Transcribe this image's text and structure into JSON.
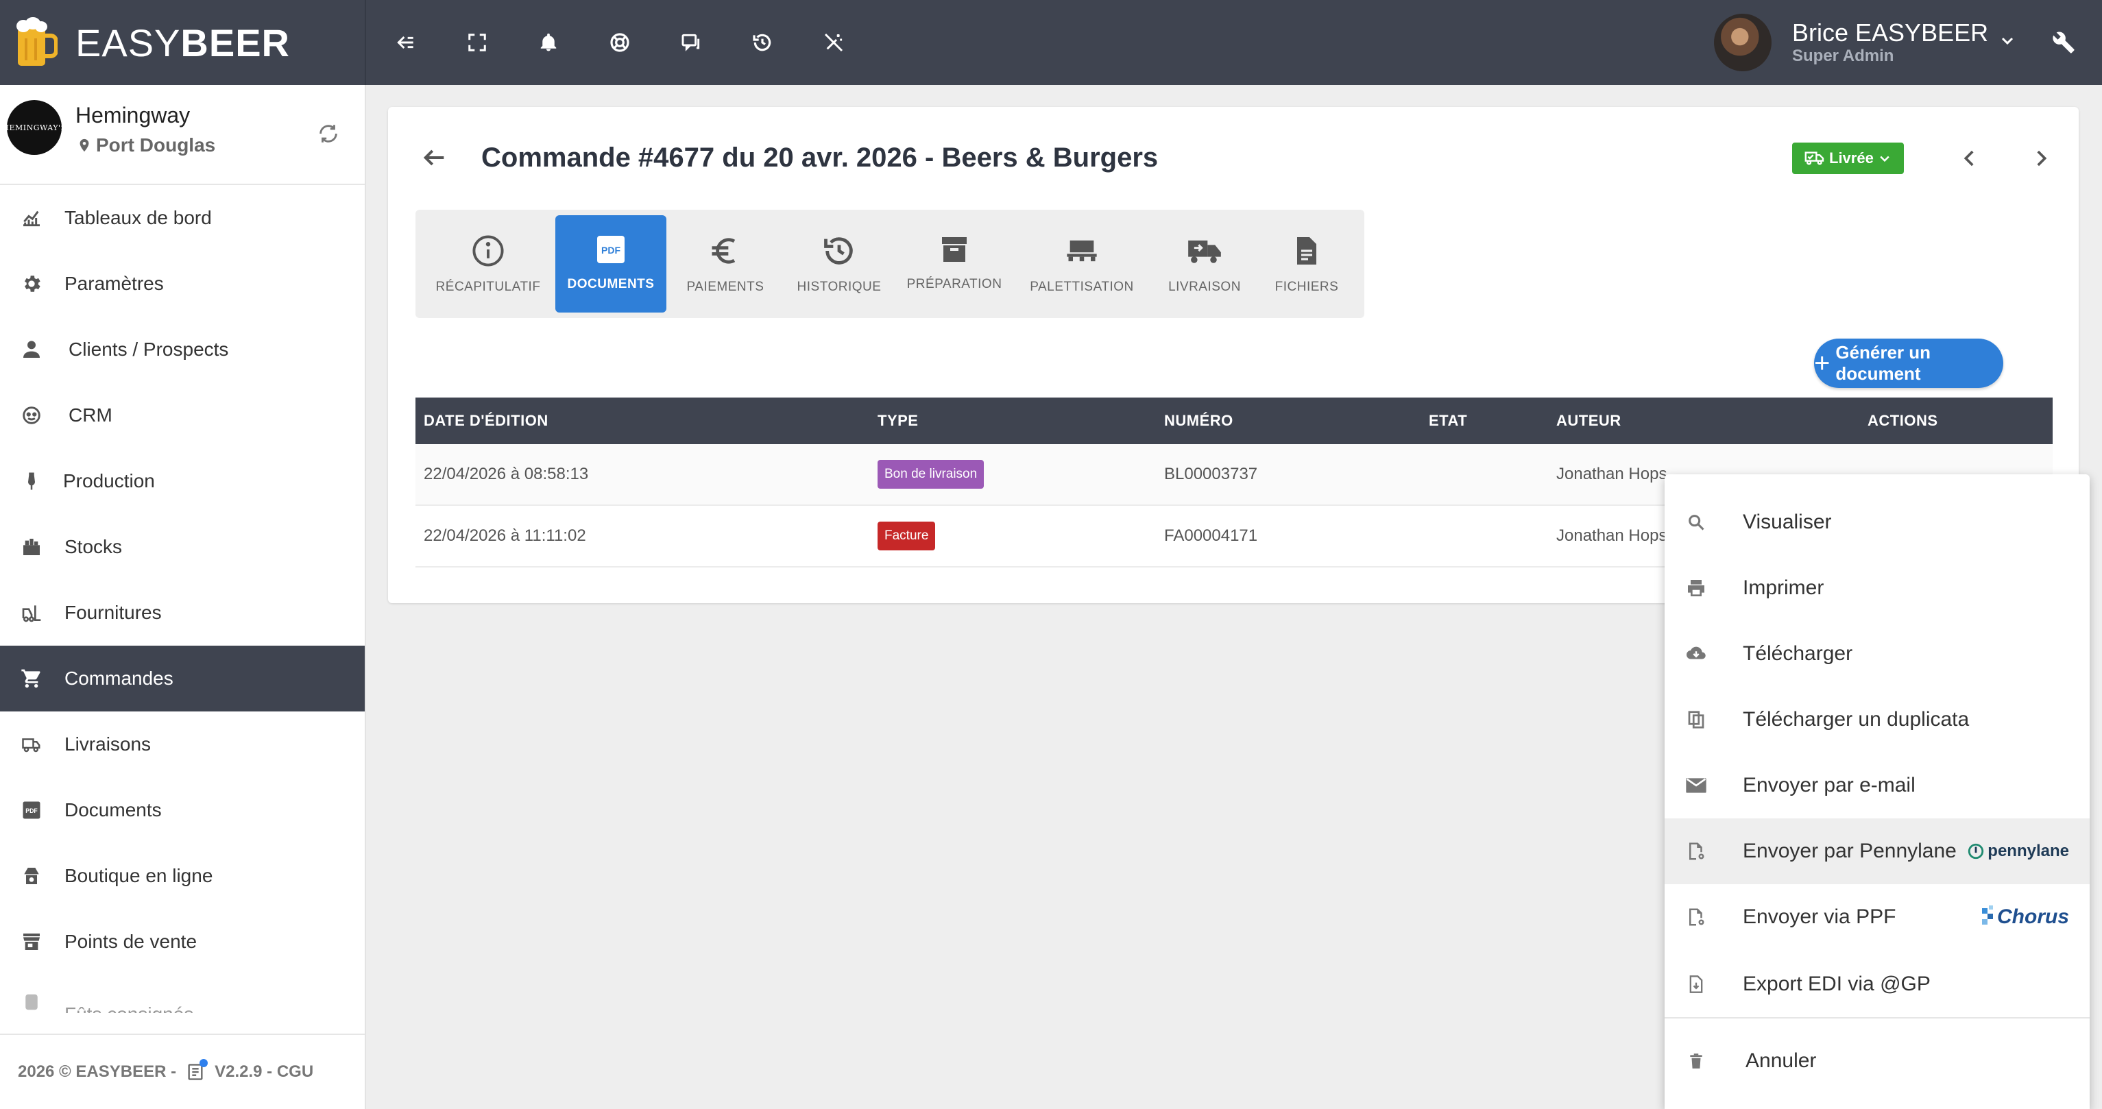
{
  "app": {
    "brand_light": "EASY",
    "brand_bold": "BEER",
    "user_name": "Brice EASYBEER",
    "user_role": "Super Admin"
  },
  "colors": {
    "topbar": "#3f4450",
    "accent": "#2f7fd8",
    "status_green": "#3aa935",
    "badge_bl": "#9b59b6",
    "badge_fa": "#c62828"
  },
  "toolbar_icons": [
    "collapse-menu-icon",
    "fullscreen-icon",
    "bell-icon",
    "support-icon",
    "messages-icon",
    "history-icon",
    "no-magic-icon"
  ],
  "brewery": {
    "logo_text": "HEMINGWAY'S",
    "name": "Hemingway",
    "city": "Port Douglas"
  },
  "sidebar": {
    "items": [
      {
        "label": "Tableaux de bord",
        "icon": "dashboard-icon"
      },
      {
        "label": "Paramètres",
        "icon": "gear-icon"
      },
      {
        "label": "Clients / Prospects",
        "icon": "person-icon"
      },
      {
        "label": "CRM",
        "icon": "crm-icon"
      },
      {
        "label": "Production",
        "icon": "beer-tap-icon"
      },
      {
        "label": "Stocks",
        "icon": "stocks-icon"
      },
      {
        "label": "Fournitures",
        "icon": "forklift-icon"
      },
      {
        "label": "Commandes",
        "icon": "cart-icon"
      },
      {
        "label": "Livraisons",
        "icon": "truck-icon"
      },
      {
        "label": "Documents",
        "icon": "pdf-icon"
      },
      {
        "label": "Boutique en ligne",
        "icon": "shop-icon"
      },
      {
        "label": "Points de vente",
        "icon": "store-icon"
      },
      {
        "label": "Fûts consignés",
        "icon": "keg-icon"
      }
    ],
    "footer_copyright": "2026 © EASYBEER -",
    "footer_version": "V2.2.9 - CGU"
  },
  "order": {
    "title": "Commande #4677 du 20 avr. 2026 - Beers & Burgers",
    "status": "Livrée"
  },
  "tabs": [
    {
      "label": "RÉCAPITULATIF",
      "icon": "info-icon"
    },
    {
      "label": "DOCUMENTS",
      "icon": "pdf-icon"
    },
    {
      "label": "PAIEMENTS",
      "icon": "euro-icon"
    },
    {
      "label": "HISTORIQUE",
      "icon": "history-icon"
    },
    {
      "label": "PRÉPARATION",
      "icon": "archive-icon"
    },
    {
      "label": "PALETTISATION",
      "icon": "pallet-icon"
    },
    {
      "label": "LIVRAISON",
      "icon": "delivery-truck-icon"
    },
    {
      "label": "FICHIERS",
      "icon": "file-icon"
    }
  ],
  "generate_button": "Générer un document",
  "table": {
    "headers": [
      "DATE D'ÉDITION",
      "TYPE",
      "NUMÉRO",
      "ETAT",
      "AUTEUR",
      "ACTIONS"
    ],
    "rows": [
      {
        "date": "22/04/2026 à 08:58:13",
        "type": "Bon de livraison",
        "numero": "BL00003737",
        "etat": "",
        "auteur": "Jonathan Hops"
      },
      {
        "date": "22/04/2026 à 11:11:02",
        "type": "Facture",
        "numero": "FA00004171",
        "etat": "",
        "auteur": "Jonathan Hops"
      }
    ]
  },
  "menu": {
    "items": [
      {
        "label": "Visualiser",
        "icon": "search-icon"
      },
      {
        "label": "Imprimer",
        "icon": "print-icon"
      },
      {
        "label": "Télécharger",
        "icon": "cloud-download-icon"
      },
      {
        "label": "Télécharger un duplicata",
        "icon": "duplicate-icon"
      },
      {
        "label": "Envoyer par e-mail",
        "icon": "mail-icon"
      },
      {
        "label": "Envoyer par Pennylane",
        "icon": "file-gear-icon",
        "brand": "pennylane"
      },
      {
        "label": "Envoyer via PPF",
        "icon": "file-gear-icon",
        "brand": "Chorus"
      },
      {
        "label": "Export EDI via @GP",
        "icon": "file-export-icon"
      },
      {
        "label": "Annuler",
        "icon": "trash-icon"
      }
    ]
  }
}
